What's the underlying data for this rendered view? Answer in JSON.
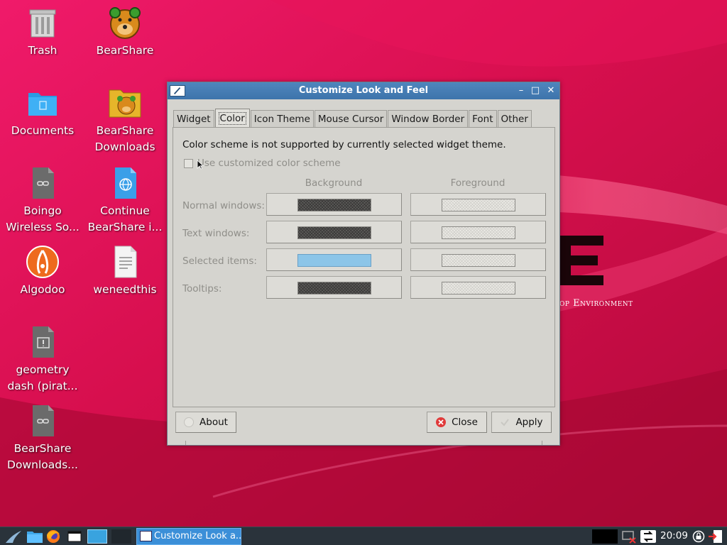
{
  "desktop": {
    "icons": [
      {
        "label": "Trash",
        "icon": "trash-icon"
      },
      {
        "label": "BearShare",
        "icon": "bearshare-icon"
      },
      {
        "label": "Documents",
        "icon": "folder-icon"
      },
      {
        "label": "BearShare Downloads",
        "icon": "bearshare-folder-icon"
      },
      {
        "label": "Boingo Wireless So...",
        "icon": "link-file-icon"
      },
      {
        "label": "Continue BearShare i...",
        "icon": "web-file-icon"
      },
      {
        "label": "Algodoo",
        "icon": "algodoo-icon"
      },
      {
        "label": "weneedthis",
        "icon": "text-file-icon"
      },
      {
        "label": "geometry dash (pirat...",
        "icon": "exec-file-icon"
      },
      {
        "label": "BearShare Downloads...",
        "icon": "link-file-icon"
      }
    ],
    "wallpaper_logo_text": "op Environment"
  },
  "window": {
    "title": "Customize Look and Feel",
    "controls": {
      "minimize": "–",
      "maximize": "□",
      "close": "✕"
    },
    "tabs": [
      {
        "label": "Widget",
        "active": false
      },
      {
        "label": "Color",
        "active": true
      },
      {
        "label": "Icon Theme",
        "active": false
      },
      {
        "label": "Mouse Cursor",
        "active": false
      },
      {
        "label": "Window Border",
        "active": false
      },
      {
        "label": "Font",
        "active": false
      },
      {
        "label": "Other",
        "active": false
      }
    ],
    "color_tab": {
      "notice": "Color scheme is not supported by currently selected widget theme.",
      "checkbox_label": "Use customized color scheme",
      "checkbox_checked": false,
      "column_background": "Background",
      "column_foreground": "Foreground",
      "rows": [
        {
          "label": "Normal windows:",
          "bg": "dark",
          "fg": "light"
        },
        {
          "label": "Text windows:",
          "bg": "dark",
          "fg": "light"
        },
        {
          "label": "Selected items:",
          "bg": "blue",
          "fg": "light"
        },
        {
          "label": "Tooltips:",
          "bg": "dark",
          "fg": "light"
        }
      ]
    },
    "buttons": {
      "about": "About",
      "close": "Close",
      "apply": "Apply"
    }
  },
  "taskbar": {
    "active_task": "Customize Look a...",
    "clock": "20:09"
  },
  "colors": {
    "wallpaper": "#d6124f",
    "titlebar": "#4a80b8",
    "taskbar": "#2a333b",
    "selected_swatch": "#8cc5e8"
  }
}
